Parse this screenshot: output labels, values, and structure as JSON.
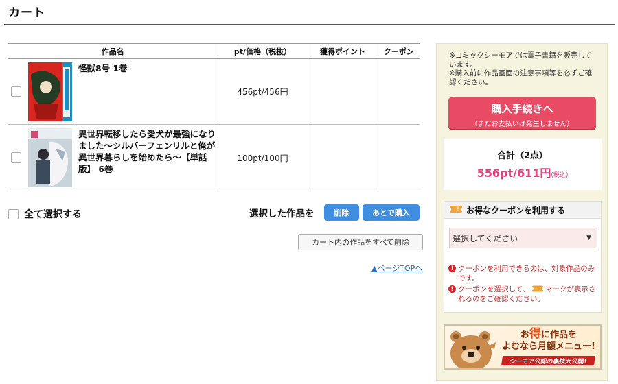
{
  "page": {
    "title": "カート"
  },
  "table": {
    "headers": [
      "作品名",
      "pt/価格（税抜）",
      "獲得ポイント",
      "クーポン"
    ],
    "rows": [
      {
        "title": "怪獣8号 1巻",
        "price": "456pt/456円",
        "points": "",
        "coupon": ""
      },
      {
        "title": "異世界転移したら愛犬が最強になりました〜シルバーフェンリルと俺が異世界暮らしを始めたら〜【単話版】 6巻",
        "price": "100pt/100円",
        "points": "",
        "coupon": ""
      }
    ]
  },
  "actions": {
    "select_all": "全て選択する",
    "selected_label": "選択した作品を",
    "delete": "削除",
    "buy_later": "あとで購入",
    "delete_all": "カート内の作品をすべて削除",
    "page_top": "▲ページTOPへ"
  },
  "sidebar": {
    "notice": "※コミックシーモアでは電子書籍を販売しています。\n※購入前に作品画面の注意事項等を必ずご確認ください。",
    "purchase_button": "購入手続きへ",
    "purchase_sub": "（まだお支払いは発生しません）",
    "total_label": "合計（2点）",
    "total_value": "556pt/611円",
    "total_tax": "(税込)",
    "coupon_heading": "お得なクーポンを利用する",
    "coupon_placeholder": "選択してください",
    "coupon_note_1": "クーポンを利用できるのは、対象作品のみです。",
    "coupon_note_2a": "クーポンを選択して、",
    "coupon_note_2b": "マークが表示されるのをご確認ください。",
    "banner_line1_a": "お",
    "banner_line1_b": "得",
    "banner_line1_c": "に作品を",
    "banner_line2": "よむなら月額メニュー!",
    "banner_strip": "シーモア公認の裏技大公開!"
  },
  "colors": {
    "accent_pink": "#e84b63",
    "price_pink": "#e0407c",
    "button_blue": "#3f8ee0",
    "sidebar_bg": "#f6f4df",
    "warning_red": "#c2332f"
  }
}
